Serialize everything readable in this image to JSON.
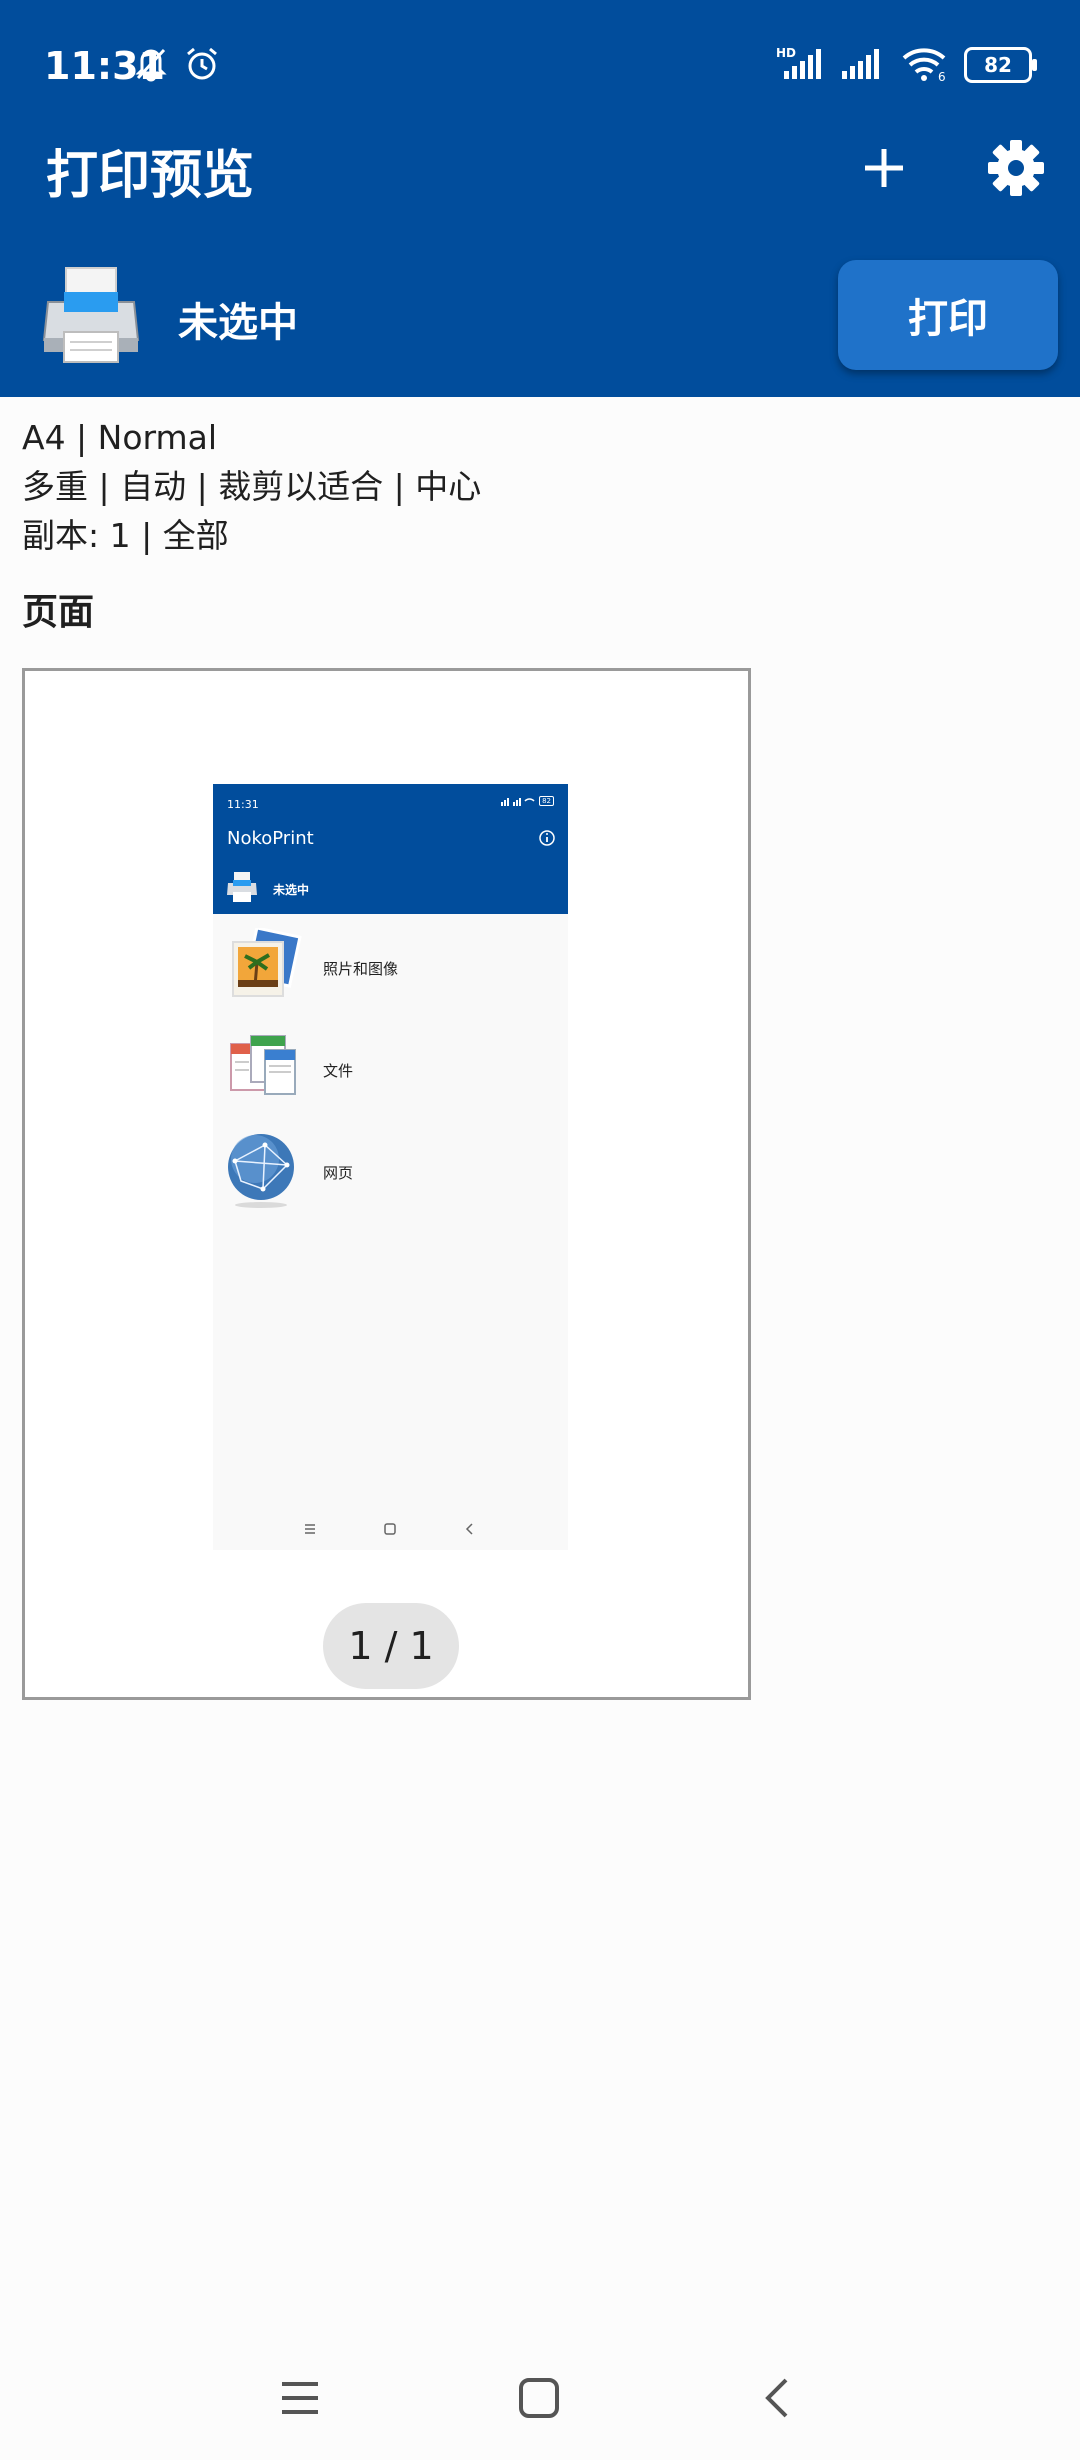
{
  "status_bar": {
    "time": "11:31",
    "battery": "82",
    "icons": [
      "muted-bell-icon",
      "alarm-icon",
      "hd-signal-icon",
      "signal-icon",
      "wifi-icon",
      "battery-icon"
    ]
  },
  "app_bar": {
    "title": "打印预览",
    "actions": [
      "add-icon",
      "gear-icon"
    ]
  },
  "printer": {
    "name": "未选中",
    "print_label": "打印"
  },
  "settings_summary": {
    "line1": "A4 | Normal",
    "line2": "多重 | 自动 | 裁剪以适合 | 中心",
    "line3": "副本: 1 | 全部"
  },
  "pages": {
    "heading": "页面",
    "indicator": "1 / 1"
  },
  "preview": {
    "status_time": "11:31",
    "battery": "82",
    "title": "NokoPrint",
    "printer_name": "未选中",
    "items": [
      {
        "label": "照片和图像",
        "icon": "photos-icon"
      },
      {
        "label": "文件",
        "icon": "documents-icon"
      },
      {
        "label": "网页",
        "icon": "globe-icon"
      }
    ]
  },
  "nav_bar": {
    "buttons": [
      "menu-icon",
      "home-icon",
      "back-icon"
    ]
  },
  "colors": {
    "header": "#014d9c",
    "print_button": "#1f72c9",
    "background": "#fcfcfc"
  }
}
